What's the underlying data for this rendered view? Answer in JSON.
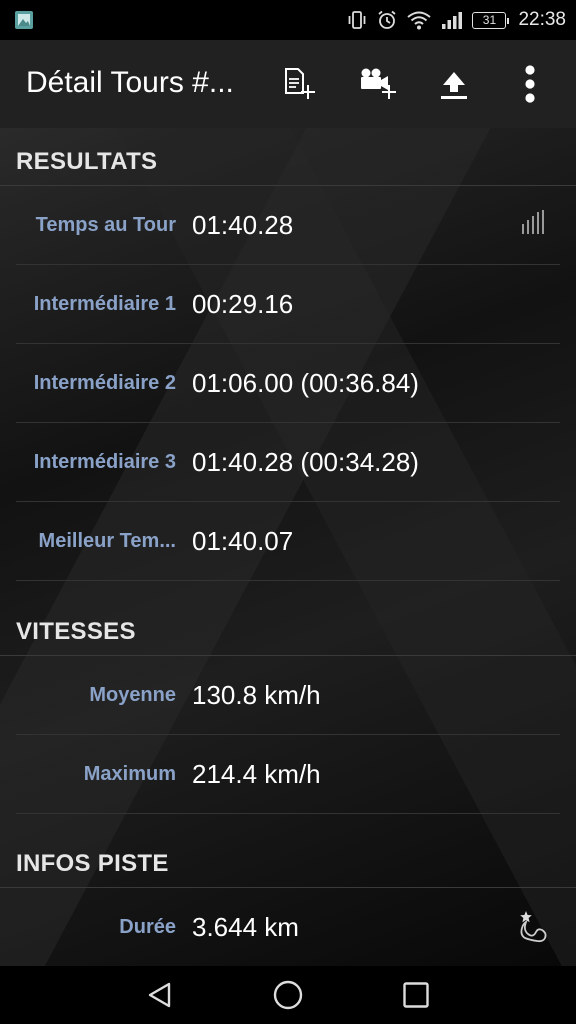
{
  "status_bar": {
    "time": "22:38",
    "battery_level": "31",
    "icons": [
      "image-icon",
      "vibrate-icon",
      "alarm-icon",
      "wifi-icon",
      "signal-icon",
      "battery-icon"
    ]
  },
  "app_bar": {
    "title": "Détail Tours #...",
    "actions": [
      "add-note-icon",
      "add-video-icon",
      "upload-icon",
      "more-vert-icon"
    ]
  },
  "sections": {
    "results": {
      "title": "RESULTATS",
      "rows": [
        {
          "label": "Temps au Tour",
          "value": "01:40.28"
        },
        {
          "label": "Intermédiaire 1",
          "value": "00:29.16"
        },
        {
          "label": "Intermédiaire 2",
          "value": "01:06.00 (00:36.84)"
        },
        {
          "label": "Intermédiaire 3",
          "value": "01:40.28 (00:34.28)"
        },
        {
          "label": "Meilleur Tem...",
          "value": "01:40.07"
        }
      ]
    },
    "speeds": {
      "title": "VITESSES",
      "rows": [
        {
          "label": "Moyenne",
          "value": "130.8 km/h"
        },
        {
          "label": "Maximum",
          "value": "214.4 km/h"
        }
      ]
    },
    "track": {
      "title": "INFOS PISTE",
      "rows": [
        {
          "label": "Durée",
          "value": "3.644 km"
        }
      ]
    }
  },
  "nav_bar": {
    "buttons": [
      "back-icon",
      "home-icon",
      "recents-icon"
    ]
  },
  "colors": {
    "label_blue": "#8aa2c8",
    "app_bar_bg": "#212121"
  }
}
